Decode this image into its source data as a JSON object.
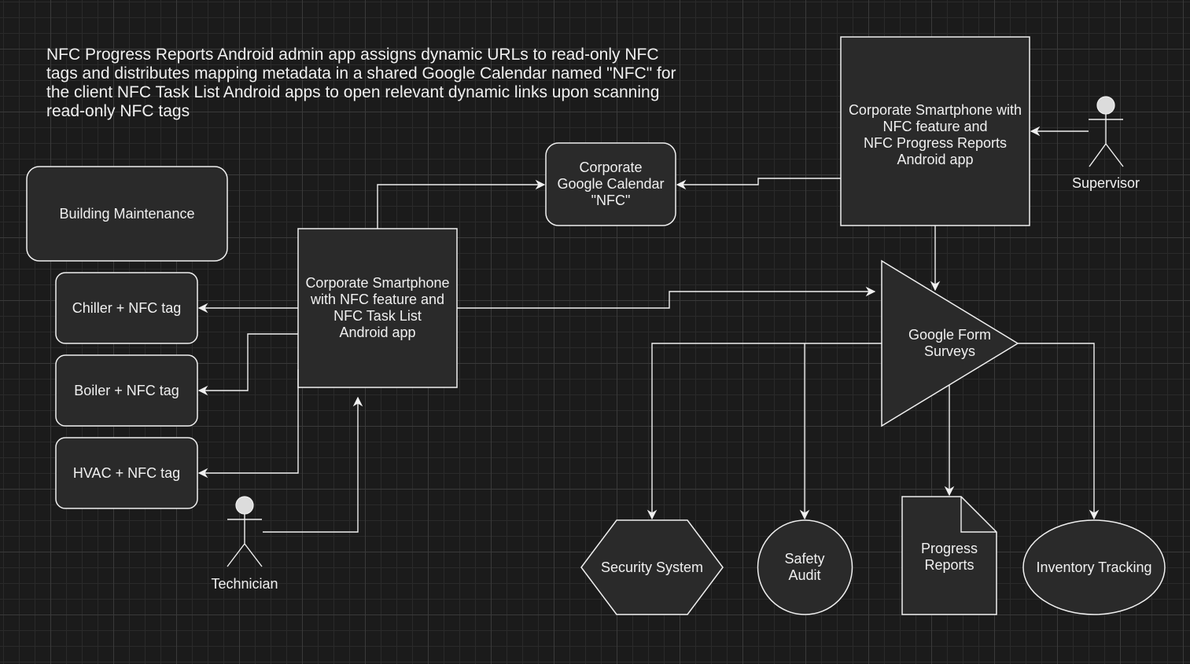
{
  "note": "NFC Progress Reports Android admin app assigns dynamic URLs to read-only NFC tags and distributes mapping metadata in a shared Google Calendar named \"NFC\" for the client NFC Task List Android apps to open relevant dynamic links upon scanning read-only NFC tags",
  "nodes": {
    "building_maintenance": "Building Maintenance",
    "chiller": "Chiller + NFC tag",
    "boiler": "Boiler + NFC tag",
    "hvac": "HVAC + NFC tag",
    "task_list_phone": "Corporate Smartphone\nwith NFC feature and\nNFC Task List\nAndroid app",
    "calendar": "Corporate\nGoogle Calendar\n\"NFC\"",
    "progress_phone": "Corporate Smartphone with\nNFC feature and\nNFC Progress Reports\nAndroid app",
    "surveys": "Google Form\nSurveys",
    "security": "Security System",
    "safety": "Safety\nAudit",
    "progress_reports": "Progress\nReports",
    "inventory": "Inventory Tracking"
  },
  "actors": {
    "supervisor": "Supervisor",
    "technician": "Technician"
  },
  "colors": {
    "background": "#1b1b1b",
    "shape_fill": "#2a2a2a",
    "stroke": "#f0f0f0"
  }
}
